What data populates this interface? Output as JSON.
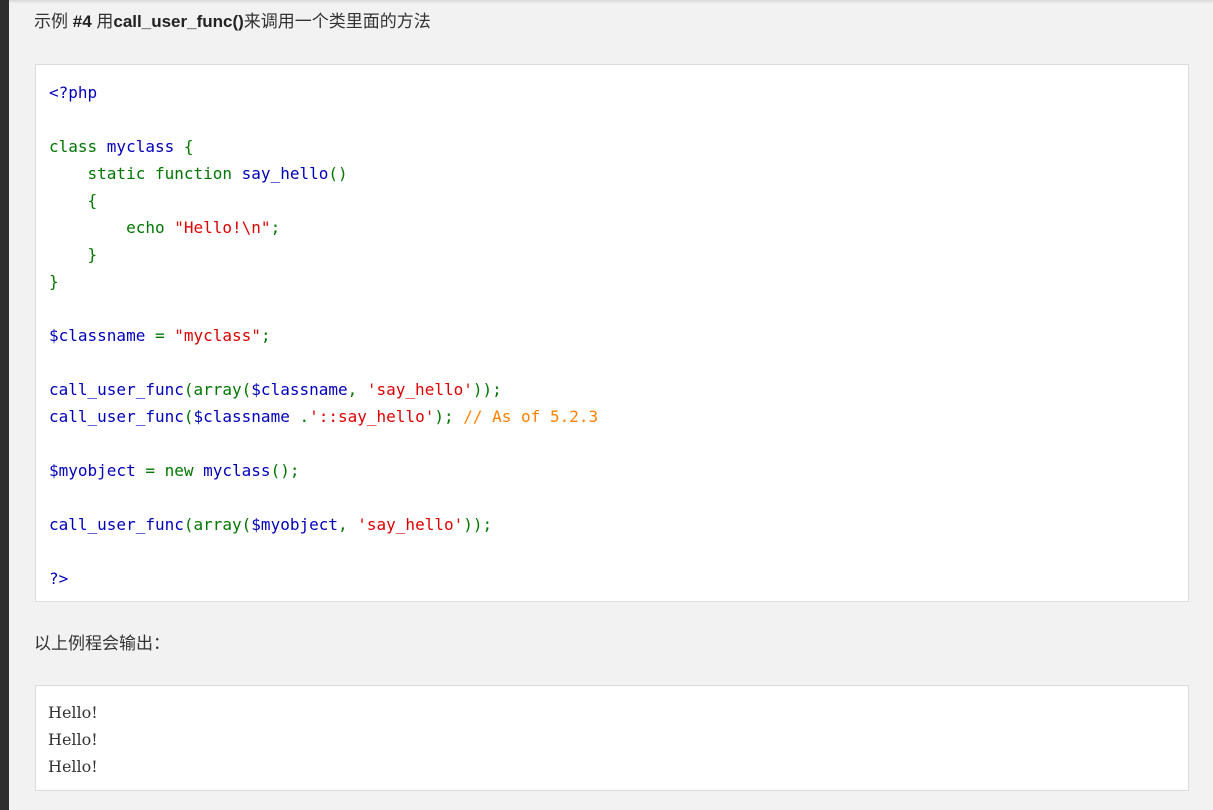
{
  "example": {
    "prefix": "示例 ",
    "number": "#4",
    "middle": " 用",
    "function_name": "call_user_func()",
    "suffix": "来调用一个类里面的方法"
  },
  "code": {
    "colors": {
      "default": "#0000bb",
      "keyword": "#007700",
      "string": "#dd0000",
      "comment": "#ff8000"
    },
    "lines": [
      [
        {
          "t": "<?php",
          "c": "default"
        }
      ],
      [],
      [
        {
          "t": "class ",
          "c": "keyword"
        },
        {
          "t": "myclass ",
          "c": "default"
        },
        {
          "t": "{",
          "c": "keyword"
        }
      ],
      [
        {
          "t": "    static function ",
          "c": "keyword"
        },
        {
          "t": "say_hello",
          "c": "default"
        },
        {
          "t": "()",
          "c": "keyword"
        }
      ],
      [
        {
          "t": "    {",
          "c": "keyword"
        }
      ],
      [
        {
          "t": "        echo ",
          "c": "keyword"
        },
        {
          "t": "\"Hello!\\n\"",
          "c": "string"
        },
        {
          "t": ";",
          "c": "keyword"
        }
      ],
      [
        {
          "t": "    }",
          "c": "keyword"
        }
      ],
      [
        {
          "t": "}",
          "c": "keyword"
        }
      ],
      [],
      [
        {
          "t": "$classname ",
          "c": "default"
        },
        {
          "t": "= ",
          "c": "keyword"
        },
        {
          "t": "\"myclass\"",
          "c": "string"
        },
        {
          "t": ";",
          "c": "keyword"
        }
      ],
      [],
      [
        {
          "t": "call_user_func",
          "c": "default"
        },
        {
          "t": "(array(",
          "c": "keyword"
        },
        {
          "t": "$classname",
          "c": "default"
        },
        {
          "t": ", ",
          "c": "keyword"
        },
        {
          "t": "'say_hello'",
          "c": "string"
        },
        {
          "t": "));",
          "c": "keyword"
        }
      ],
      [
        {
          "t": "call_user_func",
          "c": "default"
        },
        {
          "t": "(",
          "c": "keyword"
        },
        {
          "t": "$classname ",
          "c": "default"
        },
        {
          "t": ".",
          "c": "keyword"
        },
        {
          "t": "'::say_hello'",
          "c": "string"
        },
        {
          "t": "); ",
          "c": "keyword"
        },
        {
          "t": "// As of 5.2.3",
          "c": "comment"
        }
      ],
      [],
      [
        {
          "t": "$myobject ",
          "c": "default"
        },
        {
          "t": "= new ",
          "c": "keyword"
        },
        {
          "t": "myclass",
          "c": "default"
        },
        {
          "t": "();",
          "c": "keyword"
        }
      ],
      [],
      [
        {
          "t": "call_user_func",
          "c": "default"
        },
        {
          "t": "(array(",
          "c": "keyword"
        },
        {
          "t": "$myobject",
          "c": "default"
        },
        {
          "t": ", ",
          "c": "keyword"
        },
        {
          "t": "'say_hello'",
          "c": "string"
        },
        {
          "t": "));",
          "c": "keyword"
        }
      ],
      [],
      [
        {
          "t": "?>",
          "c": "default"
        }
      ]
    ]
  },
  "output": {
    "label": "以上例程会输出：",
    "lines": [
      "Hello!",
      "Hello!",
      "Hello!"
    ]
  }
}
